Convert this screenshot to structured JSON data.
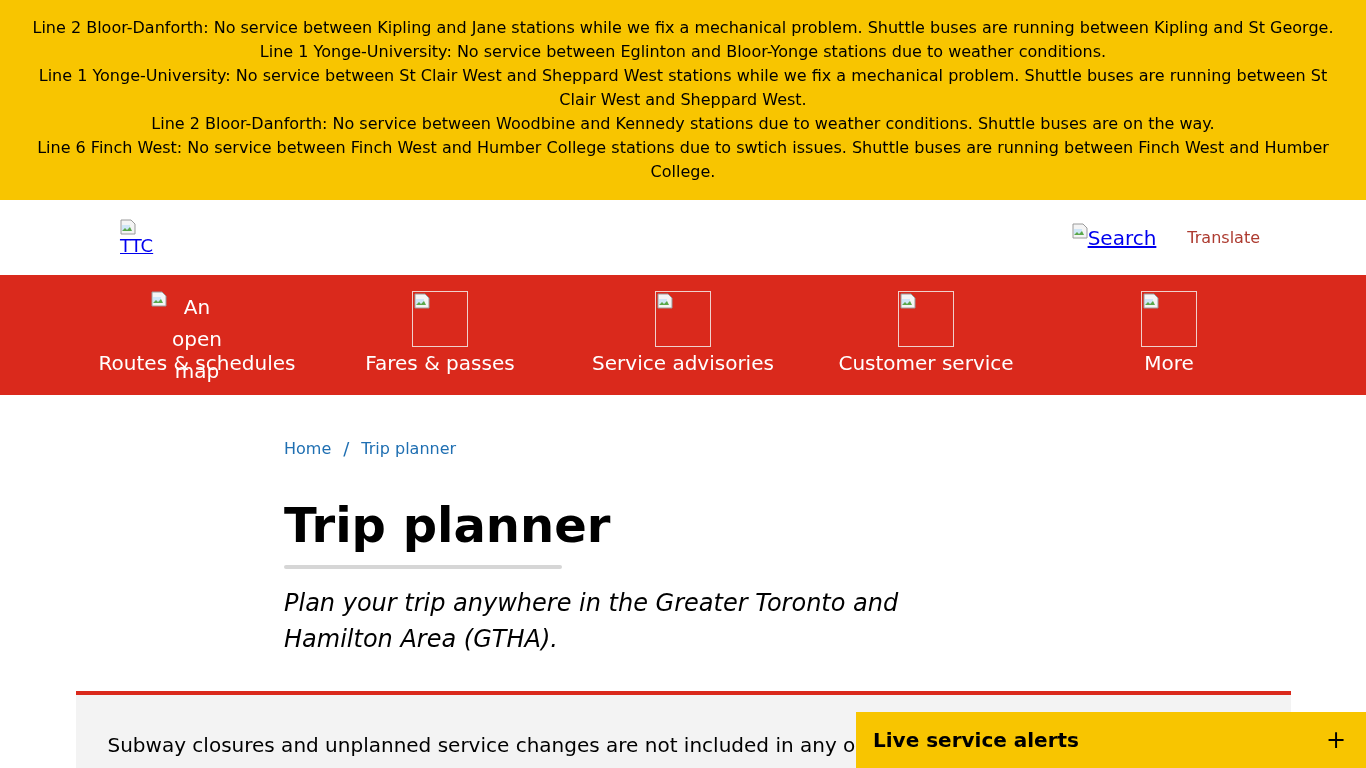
{
  "alert_banner": {
    "messages": [
      "Line 2 Bloor-Danforth: No service between Kipling and Jane stations while we fix a mechanical problem. Shuttle buses are running between Kipling and St George.",
      "Line 1 Yonge-University: No service between Eglinton and Bloor-Yonge stations due to weather conditions.",
      "Line 1 Yonge-University: No service between St Clair West and Sheppard West stations while we fix a mechanical problem. Shuttle buses are running between St Clair West and Sheppard West.",
      "Line 2 Bloor-Danforth: No service between Woodbine and Kennedy stations due to weather conditions. Shuttle buses are on the way.",
      "Line 6 Finch West: No service between Finch West and Humber College stations due to swtich issues. Shuttle buses are running between Finch West and Humber College."
    ]
  },
  "header": {
    "logo_alt": "TTC",
    "search_label": "Search",
    "translate_label": "Translate"
  },
  "main_nav": [
    {
      "label": "Routes & schedules",
      "image_alt": "An open map"
    },
    {
      "label": "Fares & passes"
    },
    {
      "label": "Service advisories"
    },
    {
      "label": "Customer service"
    },
    {
      "label": "More"
    }
  ],
  "breadcrumb": {
    "items": [
      {
        "label": "Home"
      },
      {
        "label": "Trip planner"
      }
    ],
    "separator": "/"
  },
  "page": {
    "title": "Trip planner",
    "intro": "Plan your trip anywhere in the Greater Toronto and Hamilton Area (GTHA).",
    "notice": "Subway closures and unplanned service changes are not included in any o"
  },
  "live_alerts": {
    "title": "Live service alerts",
    "toggle": "+"
  }
}
